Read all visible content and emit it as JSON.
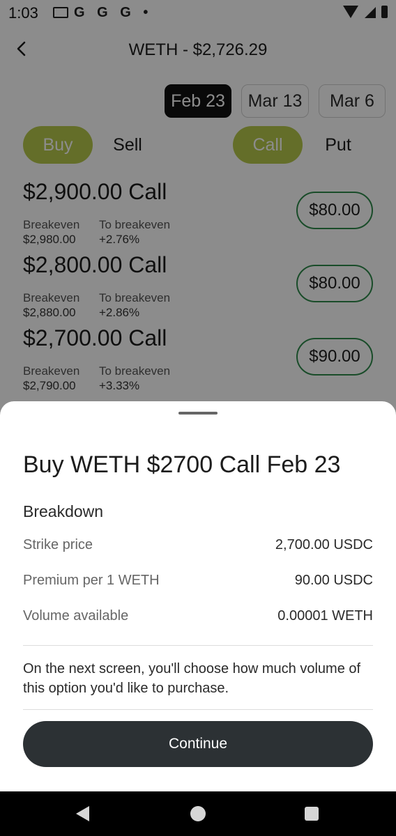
{
  "status_bar": {
    "time": "1:03",
    "notification_icons": [
      "mail-icon",
      "google-icon",
      "google-icon",
      "google-icon"
    ],
    "letters": "G G G •"
  },
  "header": {
    "title": "WETH - $2,726.29"
  },
  "dates": [
    {
      "label": "Feb 23",
      "active": true
    },
    {
      "label": "Mar 13",
      "active": false
    },
    {
      "label": "Mar 6",
      "active": false
    }
  ],
  "side_toggle": {
    "buy": "Buy",
    "sell": "Sell",
    "selected": "Buy"
  },
  "type_toggle": {
    "call": "Call",
    "put": "Put",
    "selected": "Call"
  },
  "options": [
    {
      "title": "$2,900.00 Call",
      "breakeven_label": "Breakeven",
      "breakeven": "$2,980.00",
      "to_breakeven_label": "To breakeven",
      "to_breakeven": "+2.76%",
      "price": "$80.00"
    },
    {
      "title": "$2,800.00 Call",
      "breakeven_label": "Breakeven",
      "breakeven": "$2,880.00",
      "to_breakeven_label": "To breakeven",
      "to_breakeven": "+2.86%",
      "price": "$80.00"
    },
    {
      "title": "$2,700.00 Call",
      "breakeven_label": "Breakeven",
      "breakeven": "$2,790.00",
      "to_breakeven_label": "To breakeven",
      "to_breakeven": "+3.33%",
      "price": "$90.00"
    }
  ],
  "sheet": {
    "title": "Buy WETH $2700 Call Feb 23",
    "breakdown_heading": "Breakdown",
    "rows": [
      {
        "label": "Strike price",
        "value": "2,700.00 USDC"
      },
      {
        "label": "Premium per 1 WETH",
        "value": "90.00 USDC"
      },
      {
        "label": "Volume available",
        "value": "0.00001 WETH"
      }
    ],
    "note": "On the next screen, you'll choose how much volume of this option you'd like to purchase.",
    "continue_label": "Continue"
  },
  "colors": {
    "accent_green": "#b6c94b",
    "price_border": "#2f8a4c",
    "continue_bg": "#2c3134",
    "active_date_bg": "#111111"
  }
}
